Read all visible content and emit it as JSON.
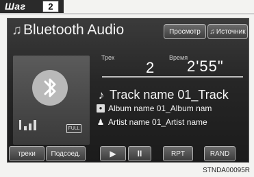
{
  "step": {
    "label": "Шаг",
    "number": "2"
  },
  "screen": {
    "title": "Bluetooth Audio",
    "view_button": "Просмотр",
    "source_button": "Источник",
    "track_label": "Трек",
    "time_label": "Время",
    "track_number": "2",
    "time_value": "2'55\"",
    "track_name": "Track name 01_Track",
    "album_name": "Album name 01_Album nam",
    "artist_name": "Artist name 01_Artist name",
    "battery_text": "FULL"
  },
  "bottom_buttons": {
    "tracks": "треки",
    "connect": "Подсоед.",
    "play": "▶",
    "pause": "II",
    "rpt": "RPT",
    "rand": "RAND"
  },
  "image_code": "STNDA00095R"
}
